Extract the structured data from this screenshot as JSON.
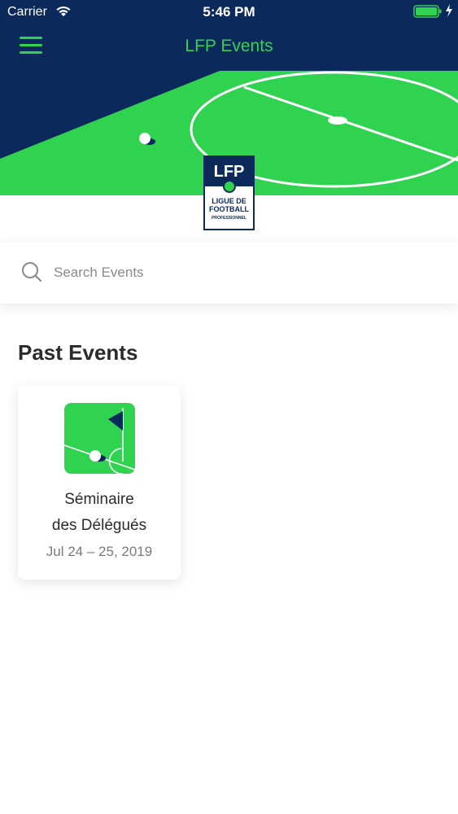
{
  "status_bar": {
    "carrier": "Carrier",
    "time": "5:46 PM"
  },
  "nav": {
    "title": "LFP Events",
    "menu_icon": "hamburger-menu-icon"
  },
  "logo": {
    "top_text": "LFP",
    "line1": "LIGUE DE",
    "line2": "FOOTBALL",
    "line3": "PROFESSIONNEL"
  },
  "search": {
    "placeholder": "Search Events",
    "value": "",
    "icon": "search-icon"
  },
  "section": {
    "title": "Past Events"
  },
  "events": [
    {
      "title_line1": "Séminaire",
      "title_line2": "des Délégués",
      "date": "Jul 24 – 25, 2019",
      "icon": "corner-flag-icon"
    }
  ],
  "colors": {
    "navy": "#0b2a5b",
    "green": "#2fd34f",
    "text": "#2b2b2b",
    "muted": "#7a7a7a"
  }
}
